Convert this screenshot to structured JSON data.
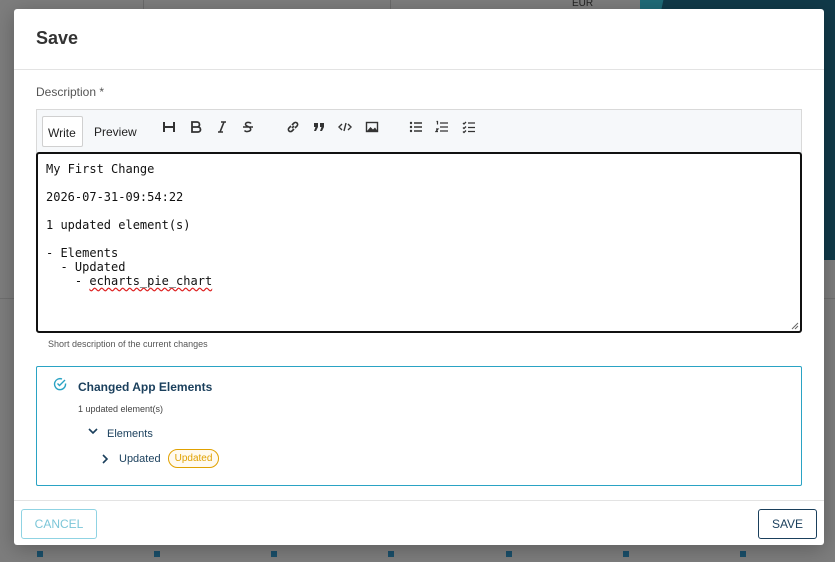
{
  "background": {
    "currency_label": "EUR"
  },
  "dialog": {
    "title": "Save",
    "description_label": "Description *",
    "tabs": {
      "write": "Write",
      "preview": "Preview"
    },
    "toolbar_icons": [
      "heading-icon",
      "bold-icon",
      "italic-icon",
      "strikethrough-icon",
      "link-icon",
      "quote-icon",
      "code-icon",
      "image-icon",
      "bulleted-list-icon",
      "numbered-list-icon",
      "task-list-icon"
    ],
    "editor_lines": [
      "My First Change",
      "",
      "2026-07-31-09:54:22",
      "",
      "1 updated element(s)",
      "",
      "- Elements",
      "  - Updated",
      "    - ",
      "echarts_pie_chart"
    ],
    "hint": "Short description of the current changes",
    "changes": {
      "title": "Changed App Elements",
      "summary": "1 updated element(s)",
      "group_label": "Elements",
      "item_label": "Updated",
      "badge": "Updated"
    },
    "buttons": {
      "cancel": "CANCEL",
      "save": "SAVE"
    }
  },
  "colors": {
    "accent": "#2aa3c4",
    "primary_text": "#1a3f5c",
    "badge": "#e0a100"
  }
}
